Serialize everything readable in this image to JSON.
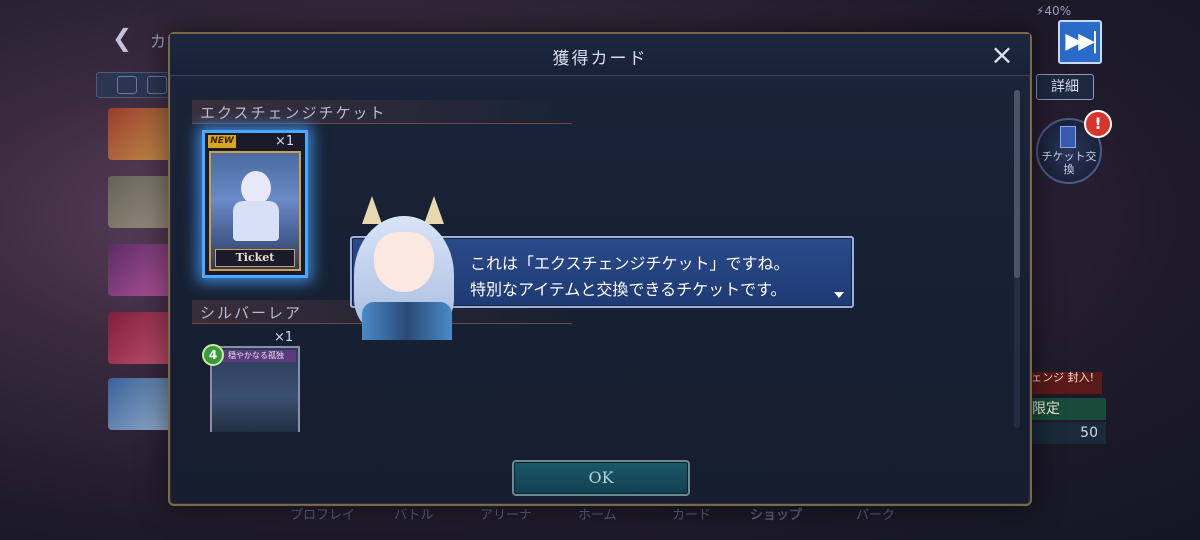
{
  "background": {
    "bottom_nav": [
      "プロフレイ",
      "バトル",
      "アリーナ",
      "ホーム",
      "カード",
      "ショップ",
      "パーク"
    ],
    "detail_label": "詳細",
    "ticket_exchange_label": "チケット交換",
    "alert_mark": "!",
    "promo": {
      "line1": "チェンジ 封入!",
      "line2": "期間限定",
      "line3": "50"
    }
  },
  "skip": {
    "icon": "fast-forward-icon",
    "glyph": "▶▶|"
  },
  "modal": {
    "title": "獲得カード",
    "close_glyph": "×",
    "sections": [
      {
        "heading": "エクスチェンジチケット",
        "cards": [
          {
            "badge": "NEW",
            "quantity": "×1",
            "label": "Ticket"
          }
        ]
      },
      {
        "heading": "シルバーレア",
        "cards": [
          {
            "cost": "4",
            "quantity": "×1",
            "name": "穏やかなる孤独"
          }
        ]
      }
    ],
    "dialog": {
      "line1": "これは「エクスチェンジチケット」ですね。",
      "line2": "特別なアイテムと交換できるチケットです。"
    },
    "ok_label": "OK"
  },
  "colors": {
    "highlight_glow": "#4aa8ff",
    "dialog_bg": "#2a4a8a",
    "modal_border": "#7a6848",
    "alert": "#d8342c"
  }
}
